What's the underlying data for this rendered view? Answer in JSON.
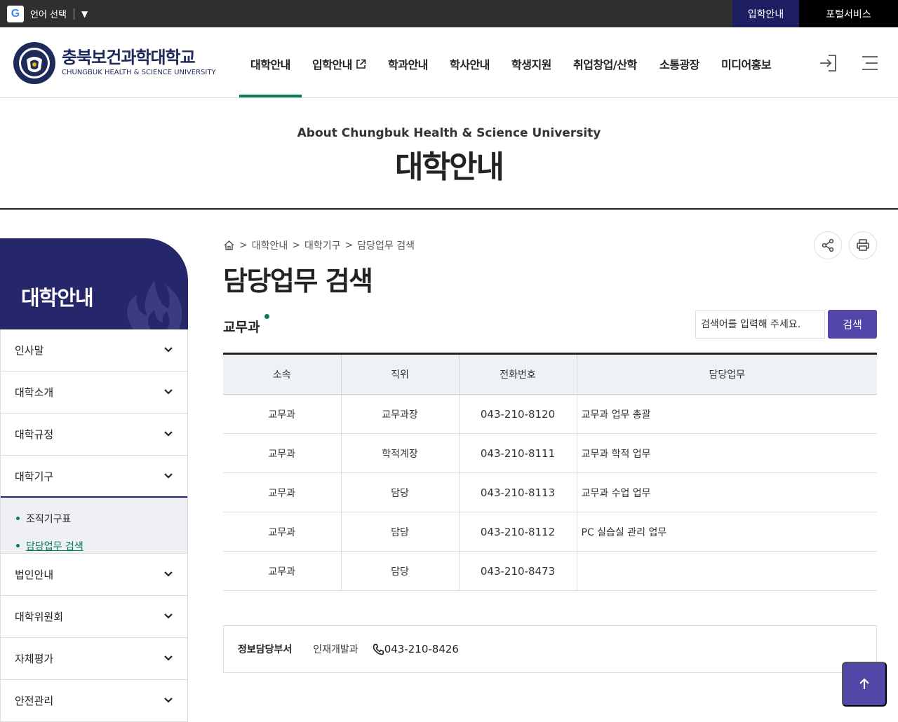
{
  "topbar": {
    "google_glyph": "G",
    "lang_label": "언어 선택",
    "lang_arrow": "▼",
    "admission_link": "입학안내",
    "portal_link": "포털서비스"
  },
  "header": {
    "logo_ko": "충북보건과학대학교",
    "logo_en": "CHUNGBUK HEALTH & SCIENCE UNIVERSITY",
    "gnb": [
      "대학안내",
      "입학안내",
      "학과안내",
      "학사안내",
      "학생지원",
      "취업창업/산학",
      "소통광장",
      "미디어홍보"
    ],
    "active_index": 0,
    "accent_color": "#0b7b56"
  },
  "title_band": {
    "subtitle_en": "About Chungbuk Health & Science University",
    "title_ko": "대학안내"
  },
  "lnb": {
    "title": "대학안내",
    "items": [
      "인사말",
      "대학소개",
      "대학규정",
      "대학기구",
      "법인안내",
      "대학위원회",
      "자체평가",
      "안전관리"
    ],
    "sub_items": [
      "조직기구표",
      "담당업무 검색"
    ],
    "brand_color": "#26266a"
  },
  "breadcrumb": [
    "대학안내",
    "대학기구",
    "담당업무 검색"
  ],
  "breadcrumb_sep": ">",
  "page_title": "담당업무 검색",
  "dept_title": "교무과",
  "search": {
    "placeholder": "검색어를 입력해 주세요.",
    "button": "검색"
  },
  "table": {
    "headers": [
      "소속",
      "직위",
      "전화번호",
      "담당업무"
    ],
    "rows": [
      [
        "교무과",
        "교무과장",
        "043-210-8120",
        "교무과 업무 총괄"
      ],
      [
        "교무과",
        "학적계장",
        "043-210-8111",
        "교무과 학적 업무"
      ],
      [
        "교무과",
        "담당",
        "043-210-8113",
        "교무과 수업 업무"
      ],
      [
        "교무과",
        "담당",
        "043-210-8112",
        "PC 실습실 관리 업무"
      ],
      [
        "교무과",
        "담당",
        "043-210-8473",
        ""
      ]
    ]
  },
  "info": {
    "label": "정보담당부서",
    "dept": "인재개발과",
    "phone": "043-210-8426"
  },
  "icons": [
    "google-icon",
    "login-icon",
    "menu-icon",
    "home-icon",
    "share-icon",
    "print-icon",
    "phone-icon",
    "arrow-up-icon",
    "external-link-icon",
    "chevron-down-icon"
  ]
}
